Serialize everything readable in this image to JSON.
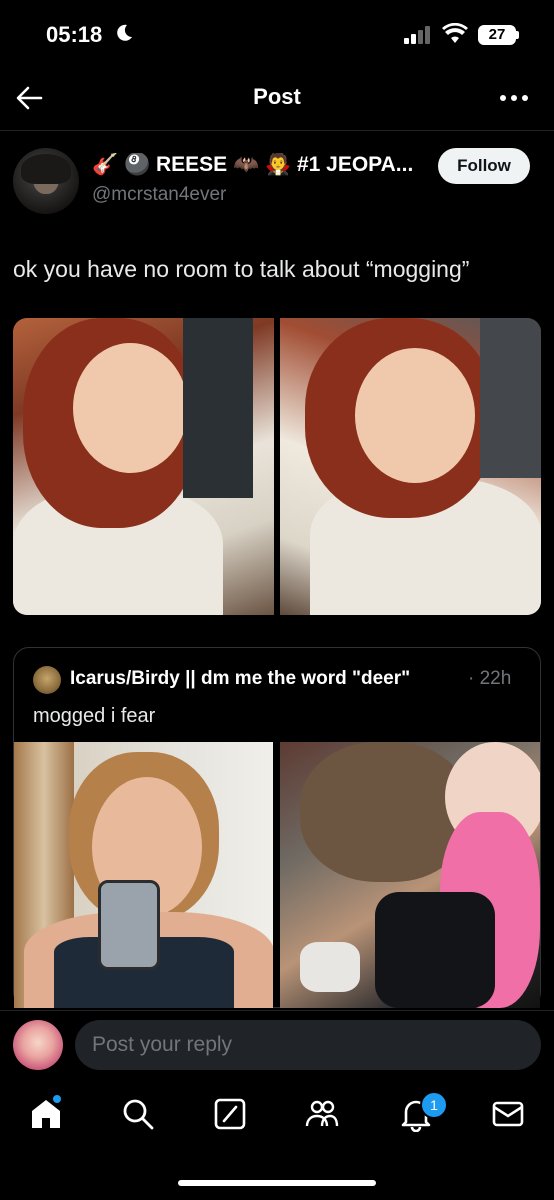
{
  "status_bar": {
    "time": "05:18",
    "battery": "27"
  },
  "header": {
    "title": "Post"
  },
  "post": {
    "author_name": "🎸 🎱 REESE 🦇 🧛 #1 JEOPA...",
    "author_handle": "@mcrstan4ever",
    "follow_label": "Follow",
    "text": "ok you have no room to talk about “mogging”"
  },
  "quote": {
    "author_name": "Icarus/Birdy || dm me the word \"deer\"",
    "time": "· 22h",
    "text": "mogged i fear"
  },
  "reply": {
    "placeholder": "Post your reply"
  },
  "tab_bar": {
    "icons": [
      "home-icon",
      "search-icon",
      "grok-icon",
      "communities-icon",
      "notifications-icon",
      "messages-icon"
    ],
    "notification_count": "1",
    "accent": "#1d9bf0"
  }
}
